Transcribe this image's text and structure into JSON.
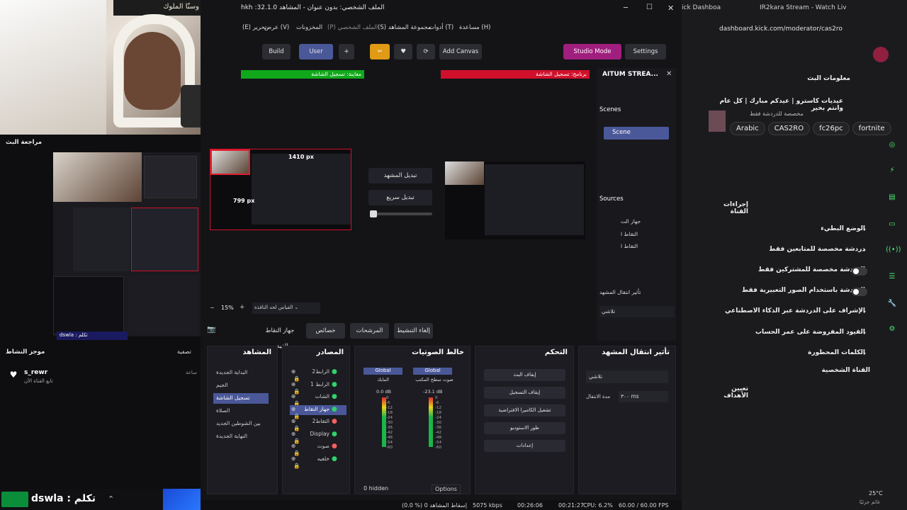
{
  "obs": {
    "title": "hkh :الملف الشخصي: بدون عنوان - المشاهد 32.1.0",
    "menu": [
      "(E) تحرير",
      "عرض (V)",
      "المخزونات",
      "(P) الملف الشخصي",
      "(S) مجموعة المشاهد",
      "أدوات (T)",
      "مساعدة (H)"
    ],
    "toolbar": {
      "build": "Build",
      "user": "User",
      "plus": "+",
      "add_canvas": "Add Canvas",
      "studio_mode": "Studio Mode",
      "settings": "Settings"
    },
    "preview_label": "معاينة: تسجيل الشاشة",
    "program_label": "برنامج: تسجيل الشاشة",
    "transition_cut": "تبديل المشهد",
    "transition_quick": "تبديل سريع",
    "dimension_w": "1410 px",
    "dimension_h": "799 px",
    "zoom": "15%",
    "scale_label": "القياس لحد النافذة",
    "prop_buttons": [
      "جهاز التقاط الفيديو",
      "خصائص",
      "المرشحات",
      "إلغاء التنشيط"
    ],
    "side": {
      "title": "AITUM STREA...",
      "scenes_label": "Scenes",
      "scene_item": "Scene",
      "sources_label": "Sources",
      "sources": [
        "جهاز الت",
        "التقاط ا",
        "التقاط ا"
      ],
      "transition_title": "تأثير انتقال المشهد",
      "transition_value": "تلاشي"
    },
    "docks": {
      "scenes": {
        "title": "المشاهد",
        "items": [
          "البداية الجديدة",
          "الجيم",
          "تسجيل الشاشة",
          "الصلاة",
          "بين الشوطين الجديد",
          "النهاية الجديدة"
        ],
        "selected": 2
      },
      "sources": {
        "title": "المصادر",
        "items": [
          "الرابط2",
          "الرابط 1",
          "الشات",
          "جهاز التقاط",
          "التقاط2",
          "Display",
          "صوت",
          "خلفيه"
        ]
      },
      "mixer": {
        "title": "خالط الصوتيات",
        "ch1_tag": "Global",
        "ch2_tag": "Global",
        "ch1_name": "المايك",
        "ch2_name": "صوت سطح المكتب",
        "ch1_db": "0.0 dB",
        "ch2_db": "-23.1 dB",
        "hidden": "0 hidden",
        "options": "Options",
        "ticks": [
          "0",
          "-6",
          "-12",
          "-18",
          "-24",
          "-30",
          "-36",
          "-42",
          "-48",
          "-54",
          "-60"
        ]
      },
      "controls": {
        "title": "التحكم",
        "buttons": [
          "إيقاف البث",
          "إيقاف التسجيل",
          "تشغيل الكاميرا الافتراضية",
          "طور الاستوديو",
          "إعدادات"
        ]
      },
      "transition": {
        "title": "تأثير انتقال المشهد",
        "value": "تلاشي",
        "duration_label": "مدة الانتقال",
        "duration": "٣٠٠ ms"
      }
    },
    "status": {
      "dropped": "(0.0 %) 0 إسقاط المشاهد",
      "kbps": "5075 kbps",
      "rec_time": "00:26:06",
      "stream_time": "00:21:27",
      "cpu": "CPU: 6.2%",
      "fps": "60.00 / 60.00 FPS"
    }
  },
  "left": {
    "banner": "تأذينا ملكتي وسنّا الملوك",
    "review_label": "مراجعة البث",
    "activity_label": "موجز النشاط",
    "filter_label": "تصفية",
    "follower_name": "s_rewr",
    "follower_sub": "تابع القناة الآن",
    "follower_time": "ساعة",
    "tab_user": "dswla : تكلم",
    "taskbar_user": "dswla : تكلم"
  },
  "browser": {
    "tabs": [
      "ick Dashboa",
      "IR2kara Stream - Watch Liv"
    ],
    "url": "dashboard.kick.com/moderator/cas2ro",
    "stream_info_title": "معلومات البث",
    "stream_title": "عيديات كاسترو | عيدكم مبارك | كل عام وانتم بخير",
    "stream_sub": "مخصصة للدردشة فقط",
    "tags": [
      "Arabic",
      "CAS2RO",
      "fc26pc",
      "fortnite"
    ],
    "channel_actions_title": "إجراءات القناة",
    "rows": [
      "الوضع البطيء",
      "دردشة مخصصة للمتابعين فقط",
      "الدردشة مخصصة للمشتركين فقط",
      "الدردشة باستخدام الصور التعبيرية فقط",
      "الإشراف على الدردشة عبر الذكاء الاصطناعي",
      "القيود المفروضة على عمر الحساب",
      "الكلمات المحظورة"
    ],
    "link_row": "القناة الشخصية",
    "targets": "تعيين الأهداف",
    "weather_temp": "25°C",
    "weather_desc": "غائم جزئيًا"
  }
}
